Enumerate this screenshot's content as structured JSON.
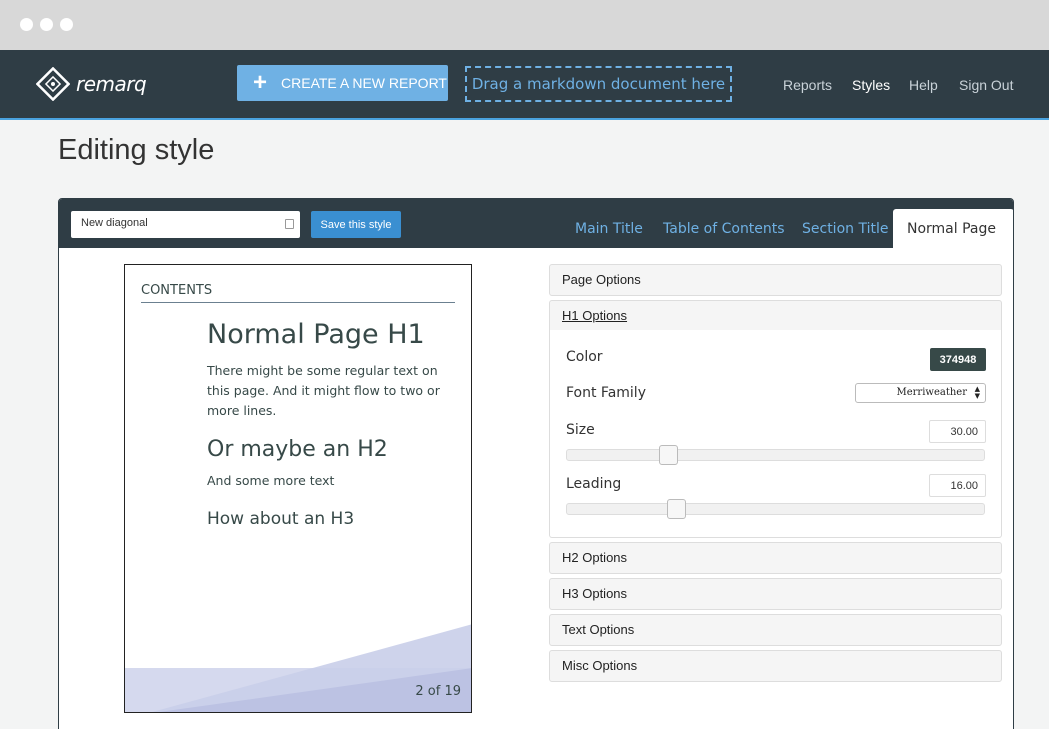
{
  "nav": {
    "brand": "remarq",
    "create_button": "CREATE A NEW REPORT",
    "drop_zone": "Drag a markdown document here",
    "links": [
      "Reports",
      "Styles",
      "Help",
      "Sign Out"
    ],
    "active_link": "Styles"
  },
  "page": {
    "title": "Editing style"
  },
  "editor": {
    "style_name": "New diagonal",
    "save_button": "Save this style",
    "tabs": [
      "Main Title",
      "Table of Contents",
      "Section Title",
      "Normal Page"
    ],
    "active_tab": "Normal Page"
  },
  "preview": {
    "contents": "CONTENTS",
    "h1": "Normal Page H1",
    "paragraph1": "There might be some regular text on this page. And it might flow to two or more lines.",
    "h2": "Or maybe an H2",
    "paragraph2": "And some more text",
    "h3": "How about an H3",
    "page_number": "2 of 19"
  },
  "options": {
    "page_options": "Page Options",
    "h1_options": "H1 Options",
    "h2_options": "H2 Options",
    "h3_options": "H3 Options",
    "text_options": "Text Options",
    "misc_options": "Misc Options",
    "h1": {
      "color_label": "Color",
      "color_value": "374948",
      "font_label": "Font Family",
      "font_value": "Merriweather",
      "size_label": "Size",
      "size_value": "30.00",
      "size_fraction": 0.23,
      "leading_label": "Leading",
      "leading_value": "16.00",
      "leading_fraction": 0.25
    }
  },
  "colors": {
    "navbar": "#2f3d45",
    "accent": "#6fb1e4",
    "heading_color": "#374948"
  }
}
